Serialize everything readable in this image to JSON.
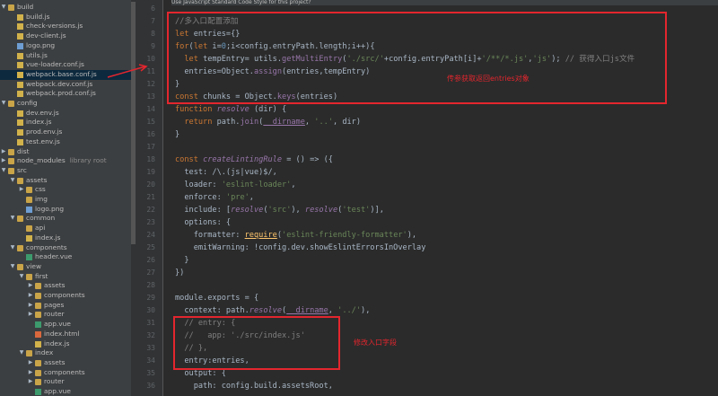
{
  "sidebar": {
    "items": [
      {
        "label": "build",
        "type": "folder",
        "depth": 0,
        "expanded": true
      },
      {
        "label": "build.js",
        "type": "js",
        "depth": 1
      },
      {
        "label": "check-versions.js",
        "type": "js",
        "depth": 1
      },
      {
        "label": "dev-client.js",
        "type": "js",
        "depth": 1
      },
      {
        "label": "logo.png",
        "type": "img",
        "depth": 1
      },
      {
        "label": "utils.js",
        "type": "js",
        "depth": 1
      },
      {
        "label": "vue-loader.conf.js",
        "type": "js",
        "depth": 1
      },
      {
        "label": "webpack.base.conf.js",
        "type": "js",
        "depth": 1,
        "selected": true
      },
      {
        "label": "webpack.dev.conf.js",
        "type": "js",
        "depth": 1
      },
      {
        "label": "webpack.prod.conf.js",
        "type": "js",
        "depth": 1
      },
      {
        "label": "config",
        "type": "folder",
        "depth": 0,
        "expanded": true
      },
      {
        "label": "dev.env.js",
        "type": "js",
        "depth": 1
      },
      {
        "label": "index.js",
        "type": "js",
        "depth": 1
      },
      {
        "label": "prod.env.js",
        "type": "js",
        "depth": 1
      },
      {
        "label": "test.env.js",
        "type": "js",
        "depth": 1
      },
      {
        "label": "dist",
        "type": "folder",
        "depth": 0,
        "expanded": false
      },
      {
        "label": "node_modules",
        "type": "folder",
        "depth": 0,
        "expanded": false,
        "tag": "library root"
      },
      {
        "label": "src",
        "type": "folder",
        "depth": 0,
        "expanded": true
      },
      {
        "label": "assets",
        "type": "folder",
        "depth": 1,
        "expanded": true
      },
      {
        "label": "css",
        "type": "folder",
        "depth": 2,
        "expanded": false
      },
      {
        "label": "img",
        "type": "folder",
        "depth": 2
      },
      {
        "label": "logo.png",
        "type": "img",
        "depth": 2
      },
      {
        "label": "common",
        "type": "folder",
        "depth": 1,
        "expanded": true
      },
      {
        "label": "api",
        "type": "folder",
        "depth": 2
      },
      {
        "label": "index.js",
        "type": "js",
        "depth": 2
      },
      {
        "label": "components",
        "type": "folder",
        "depth": 1,
        "expanded": true
      },
      {
        "label": "header.vue",
        "type": "vue",
        "depth": 2
      },
      {
        "label": "view",
        "type": "folder",
        "depth": 1,
        "expanded": true
      },
      {
        "label": "first",
        "type": "folder",
        "depth": 2,
        "expanded": true
      },
      {
        "label": "assets",
        "type": "folder",
        "depth": 3,
        "expanded": false
      },
      {
        "label": "components",
        "type": "folder",
        "depth": 3,
        "expanded": false
      },
      {
        "label": "pages",
        "type": "folder",
        "depth": 3,
        "expanded": false
      },
      {
        "label": "router",
        "type": "folder",
        "depth": 3,
        "expanded": false
      },
      {
        "label": "app.vue",
        "type": "vue",
        "depth": 3
      },
      {
        "label": "index.html",
        "type": "html",
        "depth": 3
      },
      {
        "label": "index.js",
        "type": "js",
        "depth": 3
      },
      {
        "label": "index",
        "type": "folder",
        "depth": 2,
        "expanded": true
      },
      {
        "label": "assets",
        "type": "folder",
        "depth": 3,
        "expanded": false
      },
      {
        "label": "components",
        "type": "folder",
        "depth": 3,
        "expanded": false
      },
      {
        "label": "router",
        "type": "folder",
        "depth": 3,
        "expanded": false
      },
      {
        "label": "app.vue",
        "type": "vue",
        "depth": 3
      }
    ]
  },
  "editor": {
    "hint": "Use JavaScript Standard Code Style for this project?",
    "line_numbers": [
      "6",
      "7",
      "8",
      "9",
      "10",
      "11",
      "12",
      "13",
      "14",
      "15",
      "16",
      "17",
      "18",
      "19",
      "20",
      "21",
      "22",
      "23",
      "24",
      "25",
      "26",
      "27",
      "28",
      "29",
      "30",
      "31",
      "32",
      "33",
      "34",
      "35",
      "36"
    ],
    "lines": [
      {
        "n": 6,
        "t": ""
      },
      {
        "n": 7,
        "t": "//多入口配置添加"
      },
      {
        "n": 8,
        "t": "let entries={}"
      },
      {
        "n": 9,
        "t": "for(let i=0;i<config.entryPath.length;i++){"
      },
      {
        "n": 10,
        "t": "  let tempEntry= utils.getMultiEntry('./src/'+config.entryPath[i]+'/**/*.js','js'); // 获得入口js文件"
      },
      {
        "n": 11,
        "t": "  entries=Object.assign(entries,tempEntry)"
      },
      {
        "n": 12,
        "t": "}"
      },
      {
        "n": 13,
        "t": "const chunks = Object.keys(entries)"
      },
      {
        "n": 14,
        "t": "function resolve (dir) {"
      },
      {
        "n": 15,
        "t": "  return path.join(__dirname, '..', dir)"
      },
      {
        "n": 16,
        "t": "}"
      },
      {
        "n": 17,
        "t": ""
      },
      {
        "n": 18,
        "t": "const createLintingRule = () => ({"
      },
      {
        "n": 19,
        "t": "  test: /\\.(js|vue)$/,"
      },
      {
        "n": 20,
        "t": "  loader: 'eslint-loader',"
      },
      {
        "n": 21,
        "t": "  enforce: 'pre',"
      },
      {
        "n": 22,
        "t": "  include: [resolve('src'), resolve('test')],"
      },
      {
        "n": 23,
        "t": "  options: {"
      },
      {
        "n": 24,
        "t": "    formatter: require('eslint-friendly-formatter'),"
      },
      {
        "n": 25,
        "t": "    emitWarning: !config.dev.showEslintErrorsInOverlay"
      },
      {
        "n": 26,
        "t": "  }"
      },
      {
        "n": 27,
        "t": "})"
      },
      {
        "n": 28,
        "t": ""
      },
      {
        "n": 29,
        "t": "module.exports = {"
      },
      {
        "n": 30,
        "t": "  context: path.resolve(__dirname, '../'),"
      },
      {
        "n": 31,
        "t": "  // entry: {"
      },
      {
        "n": 32,
        "t": "  //   app: './src/index.js'"
      },
      {
        "n": 33,
        "t": "  // },"
      },
      {
        "n": 34,
        "t": "  entry:entries,"
      },
      {
        "n": 35,
        "t": "  output: {"
      },
      {
        "n": 36,
        "t": "    path: config.build.assetsRoot,"
      }
    ]
  },
  "annotations": {
    "note_chunks": "传参获取返回entries对象",
    "note_entry": "修改入口字段"
  },
  "colors": {
    "highlight_border": "#e3262e",
    "selection": "#0d293e"
  }
}
